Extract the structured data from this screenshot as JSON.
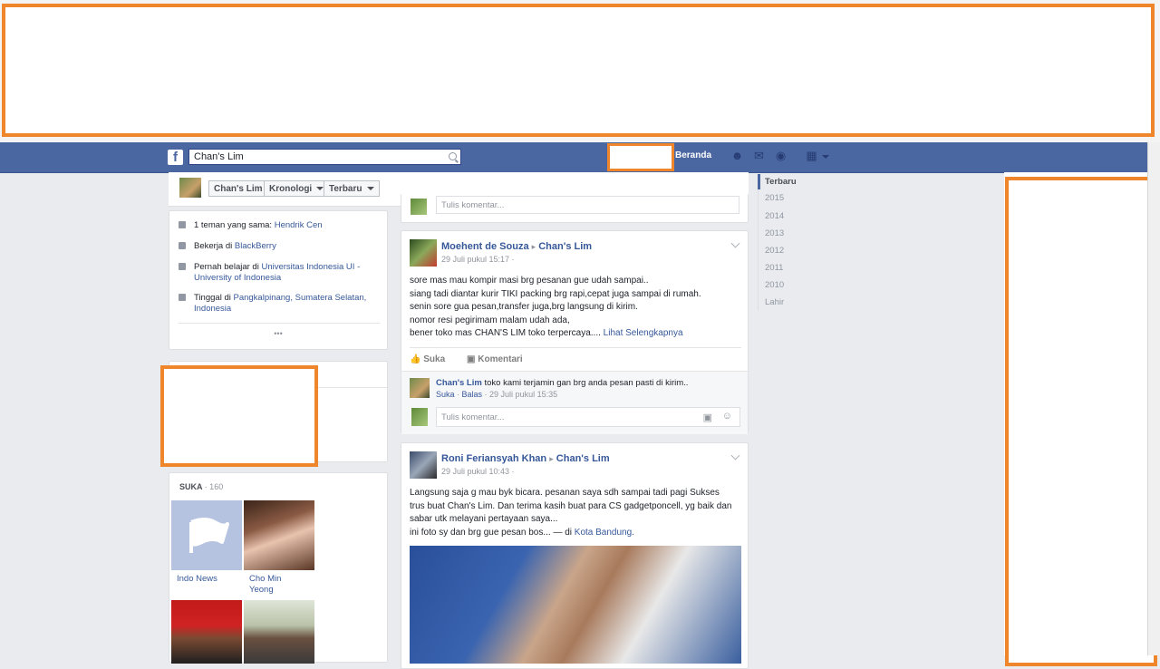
{
  "header": {
    "logo": "f",
    "search_value": "Chan's Lim",
    "home_label": "Beranda",
    "icons": [
      "friends-icon",
      "messages-icon",
      "globe-icon",
      "settings-icon"
    ]
  },
  "subnav": {
    "name": "Chan's Lim",
    "timeline": "Kronologi",
    "recent": "Terbaru"
  },
  "about": {
    "mutual_prefix": "1 teman yang sama: ",
    "mutual_name": "Hendrik Cen",
    "work_prefix": "Bekerja di ",
    "work_place": "BlackBerry",
    "study_prefix": "Pernah belajar di ",
    "study_place_1": "Universitas Indonesia UI -",
    "study_place_2": "University of Indonesia",
    "live_prefix": "Tinggal di ",
    "live_place_1": "Pangkalpinang, Sumatera Selatan,",
    "live_place_2": "Indonesia",
    "more": "•••"
  },
  "likes": {
    "title": "SUKA",
    "count": "· 160",
    "items": [
      {
        "label_1": "Indo News",
        "label_2": ""
      },
      {
        "label_1": "Cho Min",
        "label_2": "Yeong"
      }
    ]
  },
  "top_comment_placeholder": "Tulis komentar...",
  "post1": {
    "author": "Moehent de Souza",
    "arrow": "▸",
    "target": "Chan's Lim",
    "time": "29 Juli pukul 15:17 ·",
    "lines": [
      "sore mas mau kompir masi brg pesanan gue udah sampai..",
      "siang tadi diantar kurir TIKI packing brg rapi,cepat juga sampai di rumah.",
      "senin sore gua pesan,transfer juga,brg langsung di kirim.",
      "nomor resi pegirimam malam udah ada,",
      "bener toko mas CHAN'S LIM toko terpercaya...."
    ],
    "see_more": "Lihat Selengkapnya",
    "like": "Suka",
    "comment": "Komentari",
    "reply_author": "Chan's Lim",
    "reply_text": "toko kami terjamin gan brg anda pesan pasti di kirim..",
    "reply_like": "Suka",
    "reply_reply": "Balas",
    "reply_time": "· 29 Juli pukul 15:35",
    "comment_placeholder": "Tulis komentar..."
  },
  "post2": {
    "author": "Roni Feriansyah Khan",
    "arrow": "▸",
    "target": "Chan's Lim",
    "time": "29 Juli pukul 10:43 ·",
    "lines": [
      "Langsung saja g mau byk bicara. pesanan saya sdh sampai tadi pagi Sukses",
      "trus buat Chan's Lim. Dan terima kasih buat para CS gadgetponcell, yg baik dan",
      "sabar utk melayani pertayaan saya...",
      "ini foto sy dan brg gue pesan bos... — di "
    ],
    "place": "Kota Bandung."
  },
  "timeline": [
    "Terbaru",
    "2015",
    "2014",
    "2013",
    "2012",
    "2011",
    "2010",
    "Lahir"
  ],
  "colors": {
    "fb_blue": "#4b67a1",
    "link": "#365899",
    "redact_border": "#f0862b"
  }
}
